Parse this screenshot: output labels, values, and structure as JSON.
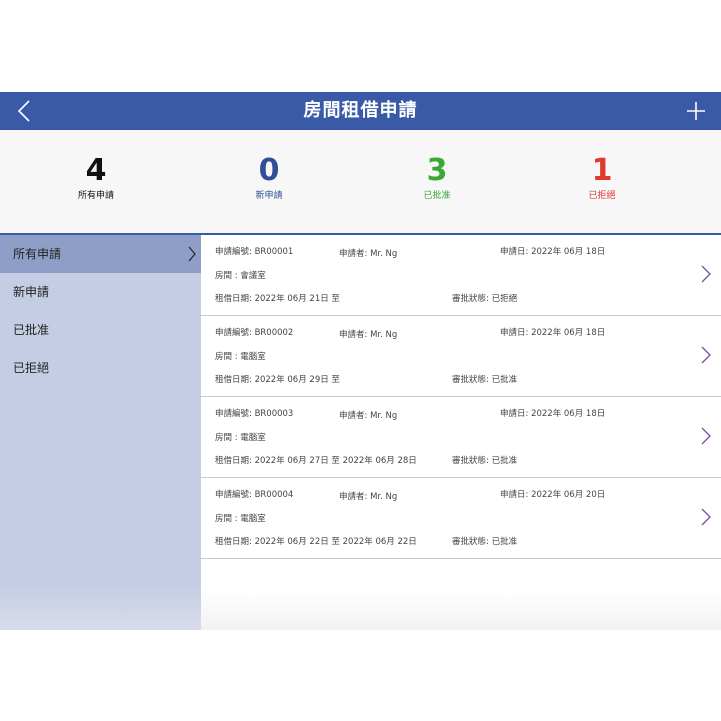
{
  "header": {
    "title": "房間租借申請",
    "back_icon": "chevron-left-icon",
    "add_icon": "plus-icon"
  },
  "stats": [
    {
      "count": "4",
      "label": "所有申請",
      "color": "#111111"
    },
    {
      "count": "0",
      "label": "新申請",
      "color": "#2f4f98"
    },
    {
      "count": "3",
      "label": "已批准",
      "color": "#3aaa35"
    },
    {
      "count": "1",
      "label": "已拒絕",
      "color": "#e03a2f"
    }
  ],
  "sidebar": {
    "items": [
      {
        "label": "所有申請",
        "active": true
      },
      {
        "label": "新申請"
      },
      {
        "label": "已批准"
      },
      {
        "label": "已拒絕"
      }
    ]
  },
  "requests": [
    {
      "id": "申請編號: BR00001",
      "applicant": "申請者: Mr. Ng",
      "apply_date": "申請日: 2022年 06月 18日",
      "room": "房間 : 會議室",
      "period": "租借日期: 2022年 06月 21日 至",
      "status": "審批狀態: 已拒絕"
    },
    {
      "id": "申請編號: BR00002",
      "applicant": "申請者: Mr. Ng",
      "apply_date": "申請日: 2022年 06月 18日",
      "room": "房間 : 電腦室",
      "period": "租借日期: 2022年 06月 29日 至",
      "status": "審批狀態: 已批准"
    },
    {
      "id": "申請編號: BR00003",
      "applicant": "申請者: Mr. Ng",
      "apply_date": "申請日: 2022年 06月 18日",
      "room": "房間 : 電腦室",
      "period": "租借日期: 2022年 06月 27日 至 2022年 06月 28日",
      "status": "審批狀態: 已批准"
    },
    {
      "id": "申請編號: BR00004",
      "applicant": "申請者: Mr. Ng",
      "apply_date": "申請日: 2022年 06月 20日",
      "room": "房間 : 電腦室",
      "period": "租借日期: 2022年 06月 22日 至 2022年 06月 22日",
      "status": "審批狀態: 已批准"
    }
  ],
  "colors": {
    "header_bg": "#3a5aa8",
    "sidebar_bg": "#c4cde3",
    "sidebar_active": "#8e9ec6",
    "chevron": "#7a4bb0"
  }
}
